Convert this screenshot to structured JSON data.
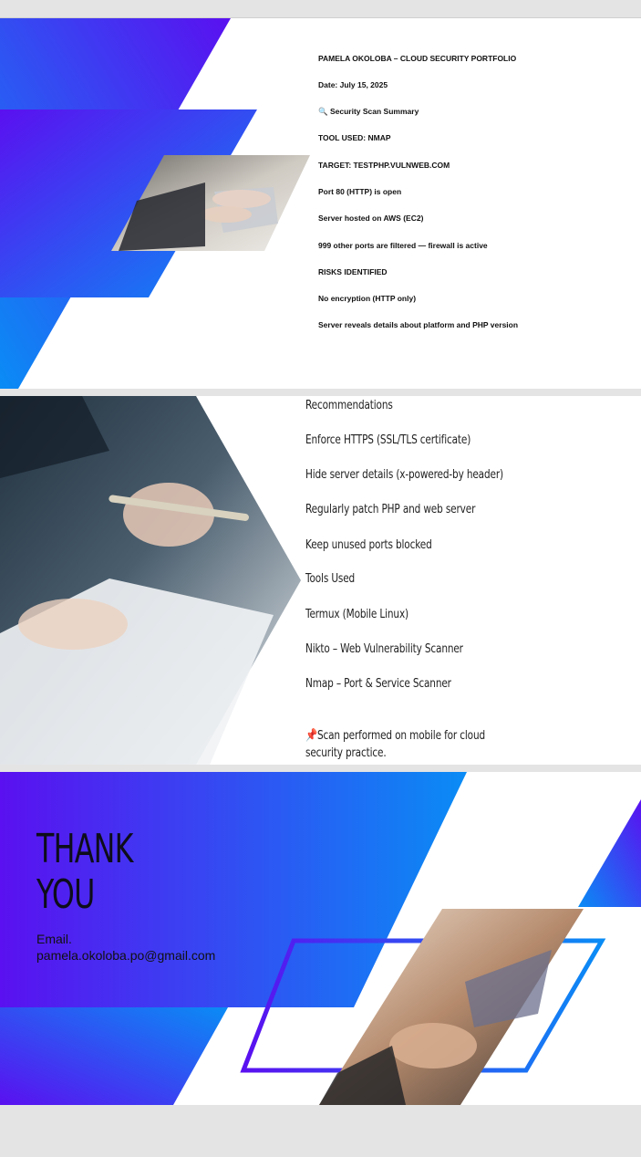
{
  "slide1": {
    "lines": [
      "PAMELA OKOLOBA – CLOUD SECURITY PORTFOLIO",
      " Date: July 15, 2025",
      "Security Scan Summary",
      "TOOL USED: NMAP",
      "TARGET: TESTPHP.VULNWEB.COM",
      "Port 80 (HTTP) is open",
      "Server hosted on AWS (EC2)",
      "999 other ports are filtered — firewall is active",
      "RISKS IDENTIFIED",
      "No encryption (HTTP only)",
      "Server reveals details about platform and PHP version"
    ],
    "search_icon": "magnifying-glass-icon",
    "photo": "hands-typing-on-laptop-photo"
  },
  "slide2": {
    "lines": [
      " Recommendations",
      "Enforce HTTPS (SSL/TLS certificate)",
      "Hide server details (x-powered-by header)",
      "Regularly patch PHP and web server",
      "Keep unused ports blocked",
      "Tools Used",
      "Termux (Mobile Linux)",
      "Nikto – Web Vulnerability Scanner",
      "Nmap – Port & Service Scanner"
    ],
    "note_line1": "Scan performed on mobile for cloud",
    "note_line2": "security practice.",
    "pin_icon": "pushpin-icon",
    "photo": "business-people-reviewing-documents-photo"
  },
  "slide3": {
    "thank_line1": "THANK",
    "thank_line2": "YOU",
    "email_label": "Email.",
    "email_value": "pamela.okoloba.po@gmail.com",
    "photo": "handshake-photo"
  },
  "colors": {
    "gradient_start": "#5a10f0",
    "gradient_end": "#0a8cf5",
    "text": "#111111"
  }
}
